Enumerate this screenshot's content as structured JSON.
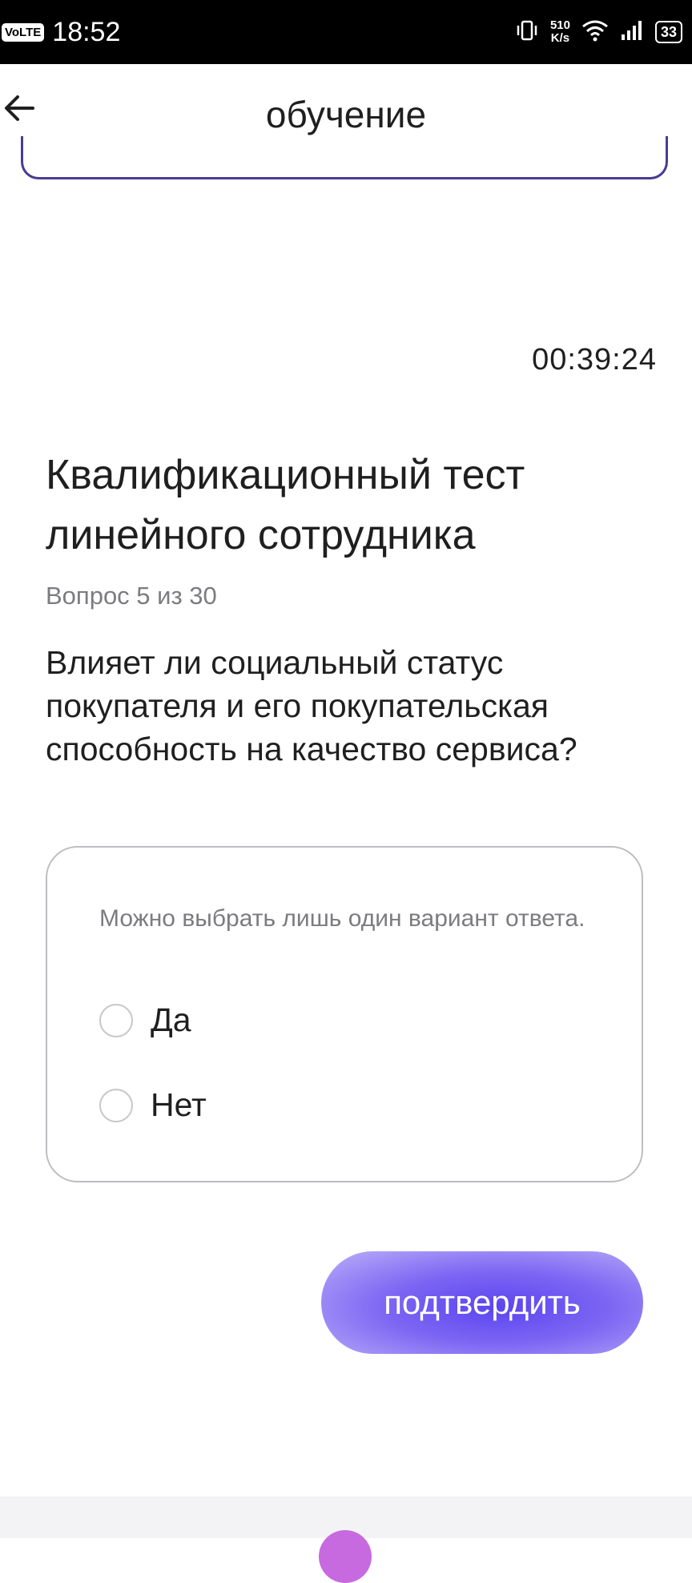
{
  "status_bar": {
    "volte": "VoLTE",
    "time": "18:52",
    "net_speed_value": "510",
    "net_speed_unit": "K/s",
    "battery": "33",
    "icons": [
      "vibrate-icon",
      "wifi-icon",
      "signal-icon",
      "battery-icon"
    ]
  },
  "header": {
    "title": "обучение",
    "back_icon": "arrow-left-icon"
  },
  "timer": "00:39:24",
  "test": {
    "title": "Квалификационный тест линейного сотрудника",
    "counter": "Вопрос 5 из 30",
    "question": "Влияет ли социальный статус покупателя и его покупательская способность на качество сервиса?"
  },
  "answers": {
    "hint": "Можно выбрать лишь один вариант ответа.",
    "options": [
      {
        "label": "Да",
        "selected": false
      },
      {
        "label": "Нет",
        "selected": false
      }
    ]
  },
  "confirm_label": "подтвердить",
  "colors": {
    "accent": "#6a55f2",
    "header_card_border": "#4b3a96",
    "muted_text": "#7c7c80"
  }
}
